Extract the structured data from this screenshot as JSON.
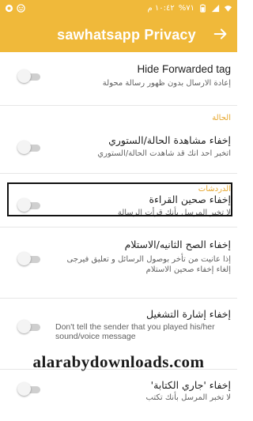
{
  "status_bar": {
    "time": "١٠:٤٢ م",
    "battery": "%٧١",
    "icons": [
      "wifi-icon",
      "signal-icon",
      "battery-icon",
      "notification-icon",
      "app-icon"
    ]
  },
  "app_bar": {
    "title": "sawhatsapp Privacy",
    "back_icon": "arrow-right-icon",
    "color": "#f0b93a"
  },
  "settings": {
    "hide_forwarded": {
      "title": "Hide Forwarded tag",
      "summary": "إعادة الارسال بدون ظهور رسالة محولة",
      "enabled": false
    },
    "section_status": "الحالة",
    "hide_status_view": {
      "title": "إخفاء مشاهدة الحالة/الستوري",
      "summary": "اتخبر احد انك قد شاهدت الحالة/الستوري",
      "enabled": false
    },
    "section_chats": "الدردشات",
    "hide_blue_ticks": {
      "title": "إخفاء صحين القراءة",
      "summary": "لا تخبر المرسل بأنك قرأت الرسالة",
      "enabled": false
    },
    "hide_second_tick": {
      "title": "إخفاء الصح الثانيه/الاستلام",
      "summary_line1": "إذا عانيت من تأخر بوصول الرسائل و تعليق فيرجى",
      "summary_line2": "إلغاء إخفاء صحين الاستلام",
      "enabled": false
    },
    "hide_play_receipt": {
      "title": "إخفاء إشارة التشغيل",
      "summary": "Don't tell the sender that you played his/her sound/voice message",
      "enabled": false
    },
    "hide_typing": {
      "title": "إخفاء 'جاري الكتابة'",
      "summary": "لا تخبر المرسل بأنك تكتب",
      "enabled": false
    }
  },
  "watermark": "alarabydownloads.com"
}
